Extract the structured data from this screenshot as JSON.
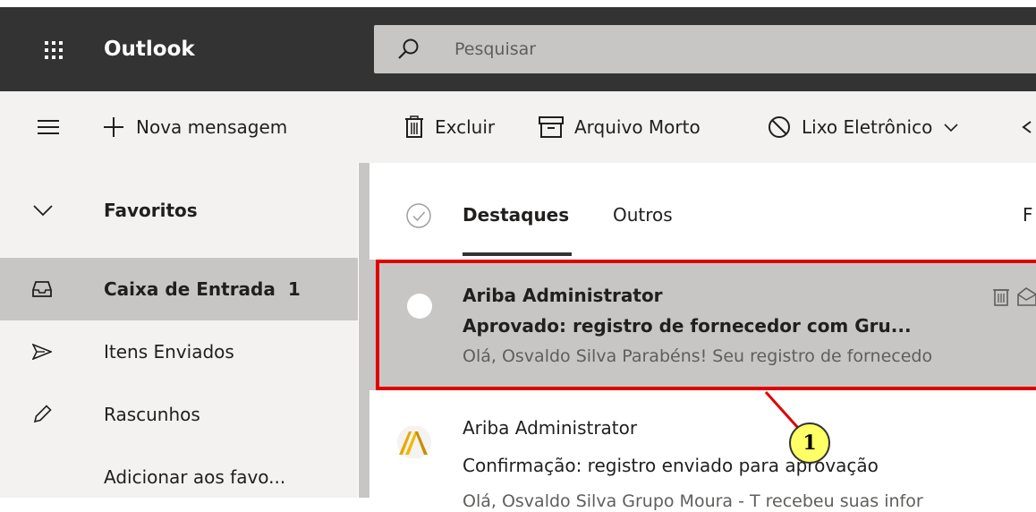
{
  "header": {
    "app_title": "Outlook",
    "search_placeholder": "Pesquisar"
  },
  "command_bar": {
    "new_message": "Nova mensagem",
    "delete": "Excluir",
    "archive": "Arquivo Morto",
    "junk": "Lixo Eletrônico"
  },
  "sidebar": {
    "favorites_label": "Favoritos",
    "items": [
      {
        "label": "Caixa de Entrada",
        "count": "1",
        "icon": "inbox-icon"
      },
      {
        "label": "Itens Enviados",
        "icon": "send-icon"
      },
      {
        "label": "Rascunhos",
        "icon": "pencil-icon"
      },
      {
        "label": "Adicionar aos favo...",
        "icon": ""
      }
    ]
  },
  "message_list": {
    "tabs": [
      {
        "label": "Destaques",
        "active": true
      },
      {
        "label": "Outros",
        "active": false
      }
    ],
    "filter_label_partial": "F",
    "messages": [
      {
        "sender": "Ariba Administrator",
        "subject": "Aprovado: registro de fornecedor com Gru...",
        "preview": "Olá, Osvaldo Silva Parabéns! Seu registro de fornecedo",
        "selected": true,
        "unread": true
      },
      {
        "sender": "Ariba Administrator",
        "subject": "Confirmação: registro enviado para aprovação",
        "preview": "Olá, Osvaldo Silva Grupo Moura - T recebeu suas infor",
        "selected": false,
        "unread": false
      }
    ]
  },
  "annotation": {
    "badge_number": "1",
    "highlight_color": "#e00000",
    "badge_color": "#ffff66"
  }
}
